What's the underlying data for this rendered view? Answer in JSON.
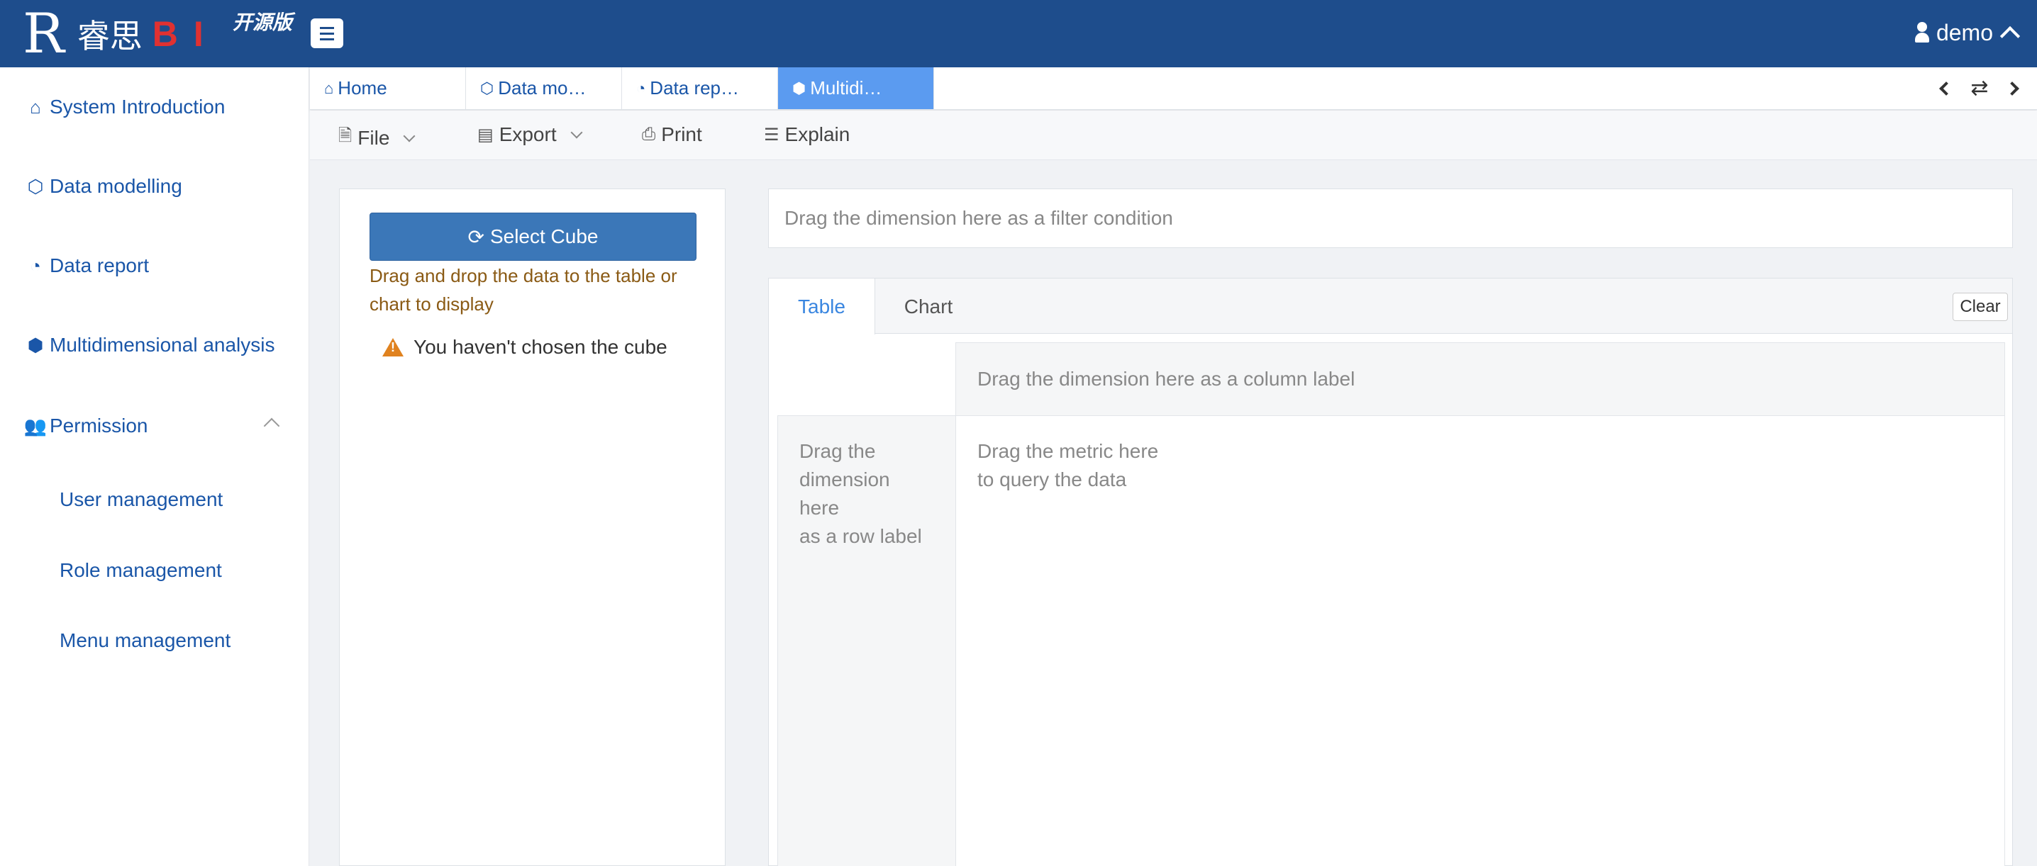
{
  "header": {
    "logo_mark": "R",
    "logo_cn": "睿思",
    "logo_bi": "BI",
    "edition": "开源版",
    "user": "demo"
  },
  "sidebar": {
    "items": [
      {
        "label": "System Introduction",
        "icon": "home-icon"
      },
      {
        "label": "Data modelling",
        "icon": "cube-icon"
      },
      {
        "label": "Data report",
        "icon": "dashboard-icon"
      },
      {
        "label": "Multidimensional analysis",
        "icon": "cubes-icon"
      },
      {
        "label": "Permission",
        "icon": "users-icon"
      }
    ],
    "sub_items": [
      "User management",
      "Role management",
      "Menu management"
    ]
  },
  "tabs": [
    {
      "label": "Home",
      "icon": "home-icon"
    },
    {
      "label": "Data mo…",
      "icon": "cube-icon"
    },
    {
      "label": "Data rep…",
      "icon": "dashboard-icon"
    },
    {
      "label": "Multidi…",
      "icon": "cubes-icon",
      "active": true
    }
  ],
  "toolbar": {
    "file": "File",
    "export": "Export",
    "print": "Print",
    "explain": "Explain"
  },
  "left_panel": {
    "select_cube": "Select Cube",
    "hint": "Drag and drop the data to the table or chart to display",
    "warning": "You haven't chosen the cube"
  },
  "filter": {
    "placeholder": "Drag the dimension here as a filter condition"
  },
  "panel": {
    "tab_table": "Table",
    "tab_chart": "Chart",
    "clear": "Clear",
    "column_zone": "Drag the dimension here as a column label",
    "row_zone": [
      "Drag the",
      "dimension",
      "here",
      "as a row label"
    ],
    "metric_zone": [
      "Drag the metric here",
      "to query the data"
    ]
  },
  "colors": {
    "header_bg": "#1e4d8c",
    "accent": "#3b77b8",
    "active_tab": "#5b9bf0",
    "warning": "#e0821f"
  }
}
